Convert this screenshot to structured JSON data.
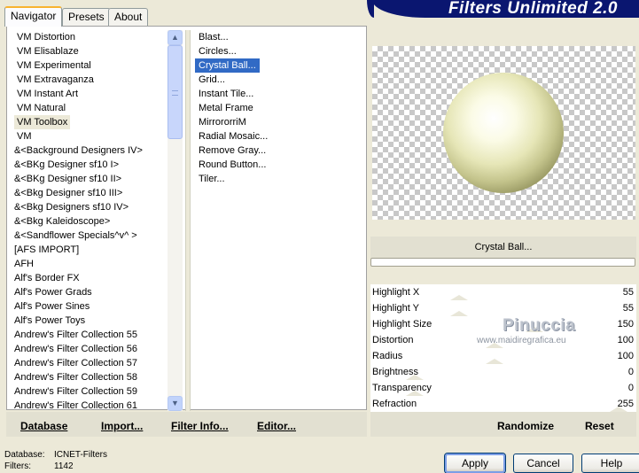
{
  "tabs": [
    "Navigator",
    "Presets",
    "About"
  ],
  "banner_title": "Filters Unlimited 2.0",
  "categories": [
    "VM Distortion",
    "VM Elisablaze",
    "VM Experimental",
    "VM Extravaganza",
    "VM Instant Art",
    "VM Natural",
    "VM Toolbox",
    "VM",
    "&<Background Designers IV>",
    "&<BKg Designer sf10 I>",
    "&<BKg Designer sf10 II>",
    "&<Bkg Designer sf10 III>",
    "&<Bkg Designers sf10 IV>",
    "&<Bkg Kaleidoscope>",
    "&<Sandflower Specials^v^ >",
    "[AFS IMPORT]",
    "AFH",
    "Alf's Border FX",
    "Alf's Power Grads",
    "Alf's Power Sines",
    "Alf's Power Toys",
    "Andrew's Filter Collection 55",
    "Andrew's Filter Collection 56",
    "Andrew's Filter Collection 57",
    "Andrew's Filter Collection 58",
    "Andrew's Filter Collection 59",
    "Andrew's Filter Collection 61"
  ],
  "selected_category": "VM Toolbox",
  "filters": [
    "Blast...",
    "Circles...",
    "Crystal Ball...",
    "Grid...",
    "Instant Tile...",
    "Metal Frame",
    "MirrororriM",
    "Radial Mosaic...",
    "Remove Gray...",
    "Round Button...",
    "Tiler..."
  ],
  "selected_filter": "Crystal Ball...",
  "preview_label": "Crystal Ball...",
  "sliders": [
    {
      "name": "Highlight X",
      "value": "55",
      "level": 0.216
    },
    {
      "name": "Highlight Y",
      "value": "55",
      "level": 0.216
    },
    {
      "name": "Highlight Size",
      "value": "150",
      "level": 0.588
    },
    {
      "name": "Distortion",
      "value": "100",
      "level": 0.392
    },
    {
      "name": "Radius",
      "value": "100",
      "level": 0.392
    },
    {
      "name": "Brightness",
      "value": "0",
      "level": 0
    },
    {
      "name": "Transparency",
      "value": "0",
      "level": 0
    },
    {
      "name": "Refraction",
      "value": "255",
      "level": 1
    }
  ],
  "watermark": {
    "line1": "Pinuccia",
    "line2": "www.maidiregrafica.eu"
  },
  "links": {
    "database": "Database",
    "import": "Import...",
    "filter_info": "Filter Info...",
    "editor": "Editor..."
  },
  "actions": {
    "randomize": "Randomize",
    "reset": "Reset"
  },
  "status": {
    "database_label": "Database:",
    "database_value": "ICNET-Filters",
    "filters_label": "Filters:",
    "filters_value": "1142"
  },
  "buttons": {
    "apply": "Apply",
    "cancel": "Cancel",
    "help": "Help"
  },
  "scroll": {
    "up_glyph": "▲",
    "down_glyph": "▼",
    "position": 0
  }
}
